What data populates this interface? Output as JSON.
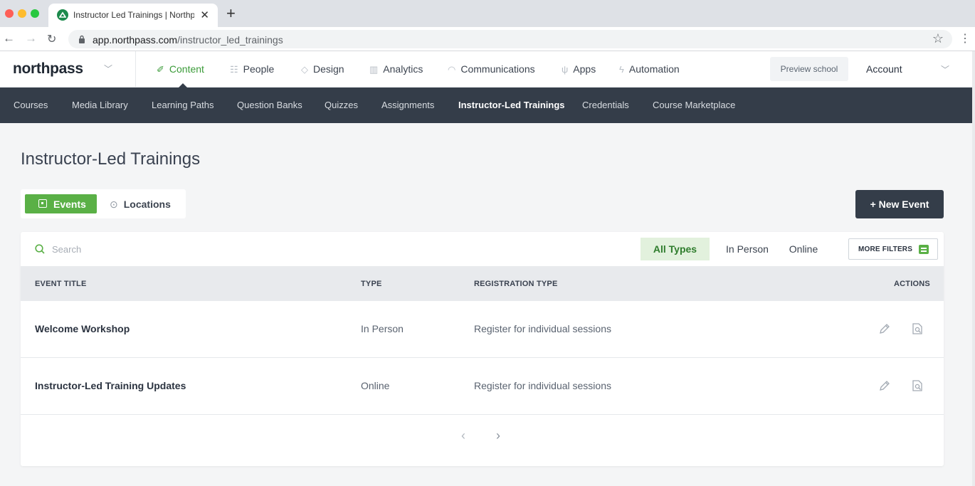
{
  "browser": {
    "tab_title": "Instructor Led Trainings | Northpass",
    "tab_close": "✕",
    "new_tab": "+",
    "url_host": "app.northpass.com",
    "url_path": "/instructor_led_trainings"
  },
  "header": {
    "logo": "northpass",
    "nav": [
      {
        "label": "Content",
        "icon": "wand-icon",
        "active": true
      },
      {
        "label": "People",
        "icon": "people-icon"
      },
      {
        "label": "Design",
        "icon": "paint-icon"
      },
      {
        "label": "Analytics",
        "icon": "chart-icon"
      },
      {
        "label": "Communications",
        "icon": "mail-icon"
      },
      {
        "label": "Apps",
        "icon": "plug-icon"
      },
      {
        "label": "Automation",
        "icon": "bolt-icon"
      }
    ],
    "preview_label": "Preview school",
    "account_label": "Account"
  },
  "subnav": [
    {
      "label": "Courses"
    },
    {
      "label": "Media Library"
    },
    {
      "label": "Learning Paths"
    },
    {
      "label": "Question Banks"
    },
    {
      "label": "Quizzes"
    },
    {
      "label": "Assignments"
    },
    {
      "label": "Instructor-Led Trainings",
      "active": true
    },
    {
      "label": "Credentials"
    },
    {
      "label": "Course Marketplace"
    }
  ],
  "page": {
    "title": "Instructor-Led Trainings",
    "seg_events": "Events",
    "seg_locations": "Locations",
    "new_event": "+ New Event"
  },
  "filters": {
    "search_placeholder": "Search",
    "all_types": "All Types",
    "in_person": "In Person",
    "online": "Online",
    "more_filters": "MORE FILTERS"
  },
  "table": {
    "headers": {
      "title": "EVENT TITLE",
      "type": "TYPE",
      "registration": "REGISTRATION TYPE",
      "actions": "ACTIONS"
    },
    "rows": [
      {
        "title": "Welcome Workshop",
        "type": "In Person",
        "registration": "Register for individual sessions"
      },
      {
        "title": "Instructor-Led Training Updates",
        "type": "Online",
        "registration": "Register for individual sessions"
      }
    ]
  },
  "pager": {
    "prev": "‹",
    "next": "›"
  },
  "colors": {
    "accent_green": "#5ab046",
    "nav_dark": "#343d49",
    "active_filter_bg": "#e2f1dd"
  }
}
